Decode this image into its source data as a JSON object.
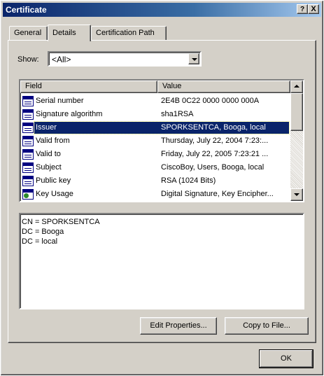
{
  "window": {
    "title": "Certificate",
    "help_btn": "?",
    "close_btn": "X"
  },
  "tabs": [
    {
      "label": "General",
      "active": false
    },
    {
      "label": "Details",
      "active": true
    },
    {
      "label": "Certification Path",
      "active": false
    }
  ],
  "show": {
    "label": "Show:",
    "selected": "<All>"
  },
  "list": {
    "columns": [
      "Field",
      "Value"
    ],
    "rows": [
      {
        "field": "Serial number",
        "value": "2E4B 0C22 0000 0000 000A",
        "icon": "cert-field-icon"
      },
      {
        "field": "Signature algorithm",
        "value": "sha1RSA",
        "icon": "cert-field-icon"
      },
      {
        "field": "Issuer",
        "value": "SPORKSENTCA, Booga, local",
        "icon": "cert-field-icon",
        "selected": true
      },
      {
        "field": "Valid from",
        "value": "Thursday, July 22, 2004 7:23:...",
        "icon": "cert-field-icon"
      },
      {
        "field": "Valid to",
        "value": "Friday, July 22, 2005 7:23:21 ...",
        "icon": "cert-field-icon"
      },
      {
        "field": "Subject",
        "value": "CiscoBoy, Users, Booga, local",
        "icon": "cert-field-icon"
      },
      {
        "field": "Public key",
        "value": "RSA (1024 Bits)",
        "icon": "cert-field-icon"
      },
      {
        "field": "Key Usage",
        "value": "Digital Signature, Key Encipher...",
        "icon": "key-usage-icon"
      }
    ]
  },
  "detail": {
    "lines": [
      "CN = SPORKSENTCA",
      "DC = Booga",
      "DC = local"
    ]
  },
  "buttons": {
    "edit": "Edit Properties...",
    "copy": "Copy to File...",
    "ok": "OK"
  },
  "colors": {
    "selection": "#0a246a",
    "face": "#d4d0c8"
  }
}
